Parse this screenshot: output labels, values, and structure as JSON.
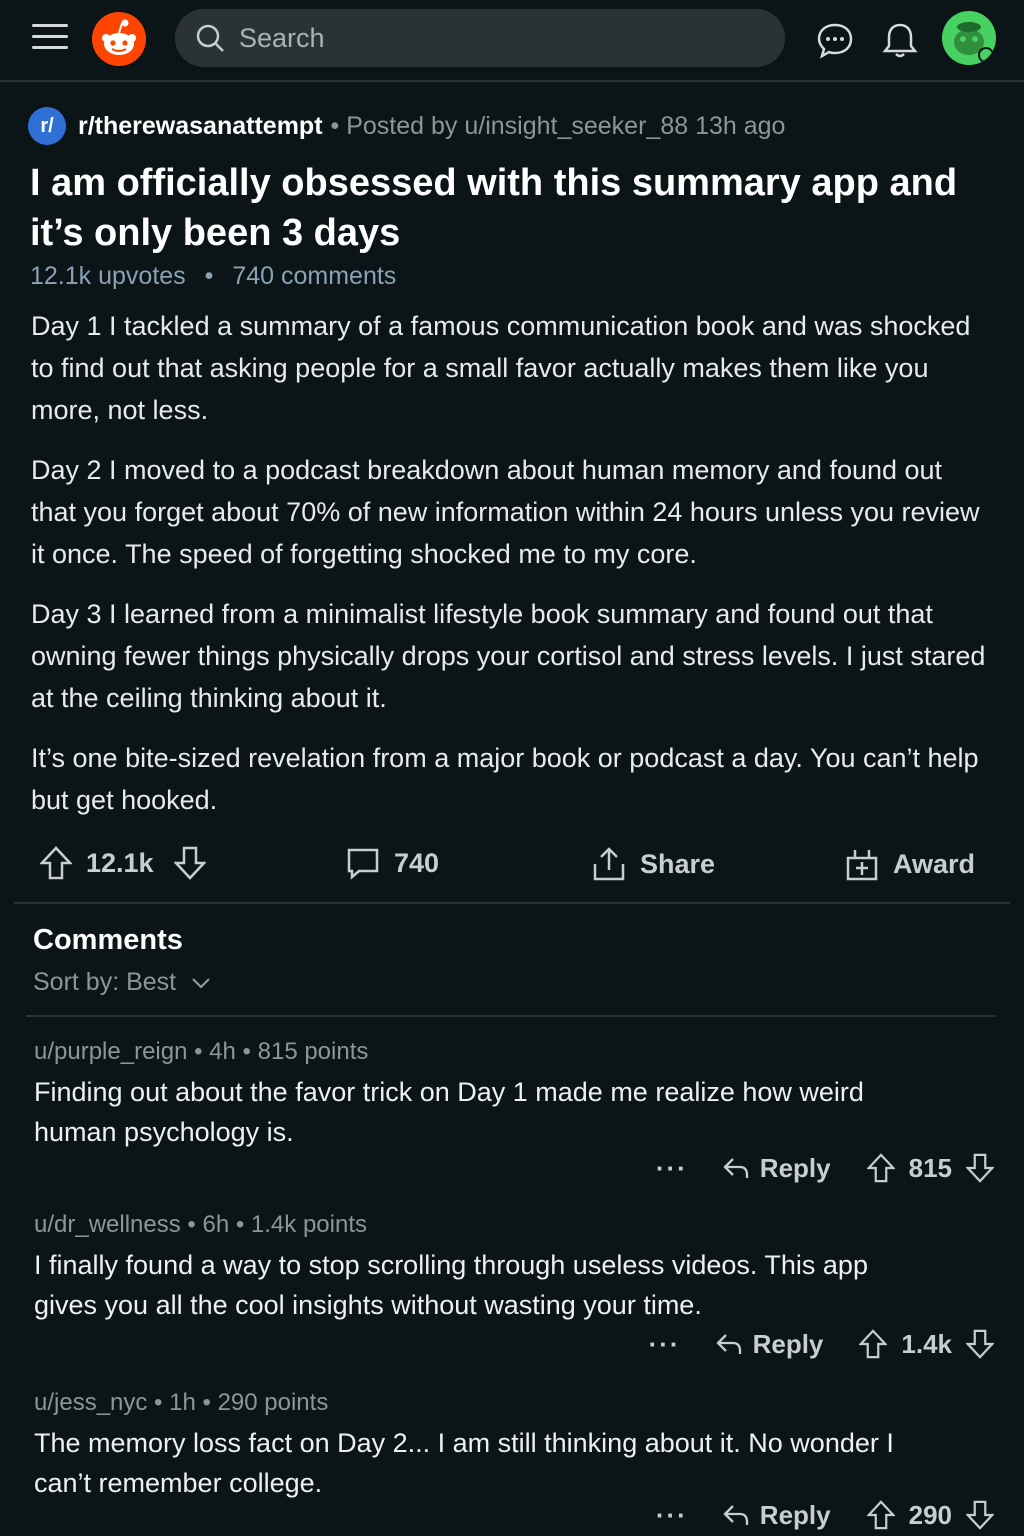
{
  "header": {
    "search_placeholder": "Search"
  },
  "post": {
    "subreddit_icon": "r/",
    "subreddit": "r/therewasanattempt",
    "meta": "• Posted by u/insight_seeker_88 13h ago",
    "title": "I am officially obsessed with this summary app and it’s only been 3 days",
    "upvotes": "12.1k upvotes",
    "comments": "740 comments",
    "body": [
      "Day 1 I tackled a summary of a famous communication book and was shocked to find out that asking people for a small favor actually makes them like you more, not less.",
      "Day 2 I moved to a podcast breakdown about human memory and found out that you forget about 70% of new information within 24 hours unless you review it once. The speed of forgetting shocked me to my core.",
      "Day 3 I learned from a minimalist lifestyle book summary and found out that owning fewer things physically drops your cortisol and stress levels. I just stared at the ceiling thinking about it.",
      "It’s one bite-sized revelation from a major book or podcast a day. You can’t help but get hooked."
    ],
    "actions": {
      "votes": "12.1k",
      "comments": "740",
      "share": "Share",
      "award": "Award"
    }
  },
  "comments_section": {
    "heading": "Comments",
    "sort": "Sort by: Best",
    "reply_label": "Reply",
    "more_label": "···",
    "items": [
      {
        "meta": "u/purple_reign • 4h • 815 points",
        "text": "Finding out about the favor trick on Day 1 made me realize how weird human psychology is.",
        "votes": "815"
      },
      {
        "meta": "u/dr_wellness • 6h • 1.4k points",
        "text": "I finally found a way to stop scrolling through useless videos. This app gives you all the cool insights without wasting your time.",
        "votes": "1.4k"
      },
      {
        "meta": "u/jess_nyc • 1h • 290 points",
        "text": "The memory loss fact on Day 2... I am still thinking about it. No wonder I can’t remember college.",
        "votes": "290"
      }
    ]
  },
  "colors": {
    "background": "#0b1416",
    "brand": "#ff4500",
    "subreddit_icon": "#2f6fd6",
    "avatar": "#46d160"
  },
  "icons": [
    "menu-icon",
    "reddit-logo-icon",
    "search-icon",
    "chat-icon",
    "bell-icon",
    "avatar-icon",
    "upvote-icon",
    "downvote-icon",
    "comment-icon",
    "share-icon",
    "award-icon",
    "reply-icon",
    "chevron-down-icon"
  ]
}
